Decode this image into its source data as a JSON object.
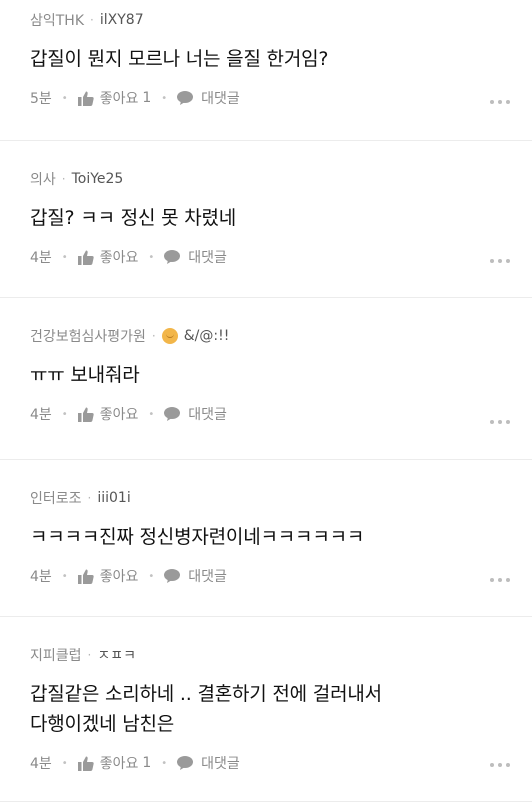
{
  "comments": [
    {
      "department": "삼익THK",
      "nickname": "ilXY87",
      "text_lines": [
        "갑질이 뭔지 모르나 너는 을질 한거임?"
      ],
      "time": "5분",
      "like_label": "좋아요",
      "like_count": "1",
      "reply_label": "대댓글",
      "has_avatar": false
    },
    {
      "department": "의사",
      "nickname": "ToiYe25",
      "text_lines": [
        "갑질? ㅋㅋ 정신 못 차렸네"
      ],
      "time": "4분",
      "like_label": "좋아요",
      "like_count": "",
      "reply_label": "대댓글",
      "has_avatar": false
    },
    {
      "department": "건강보험심사평가원",
      "nickname": "&/@:!!",
      "text_lines": [
        "ㅠㅠ 보내줘라"
      ],
      "time": "4분",
      "like_label": "좋아요",
      "like_count": "",
      "reply_label": "대댓글",
      "has_avatar": true
    },
    {
      "department": "인터로조",
      "nickname": "iii01i",
      "text_lines": [
        "ㅋㅋㅋㅋ진짜 정신병자련이네ㅋㅋㅋㅋㅋㅋ"
      ],
      "time": "4분",
      "like_label": "좋아요",
      "like_count": "",
      "reply_label": "대댓글",
      "has_avatar": false
    },
    {
      "department": "지피클럽",
      "nickname": "ㅈㅍㅋ",
      "text_lines": [
        "갑질같은 소리하네 .. 결혼하기 전에 걸러내서",
        "다행이겠네 남친은"
      ],
      "time": "4분",
      "like_label": "좋아요",
      "like_count": "1",
      "reply_label": "대댓글",
      "has_avatar": false
    }
  ],
  "colors": {
    "background": "#ffffff",
    "meta_text": "#8a8a8a",
    "body_text": "#111111",
    "divider": "#ececec",
    "avatar": "#f2b64a"
  },
  "icons": [
    "thumb-up-icon",
    "speech-bubble-icon",
    "more-dots-icon",
    "avatar-icon"
  ]
}
